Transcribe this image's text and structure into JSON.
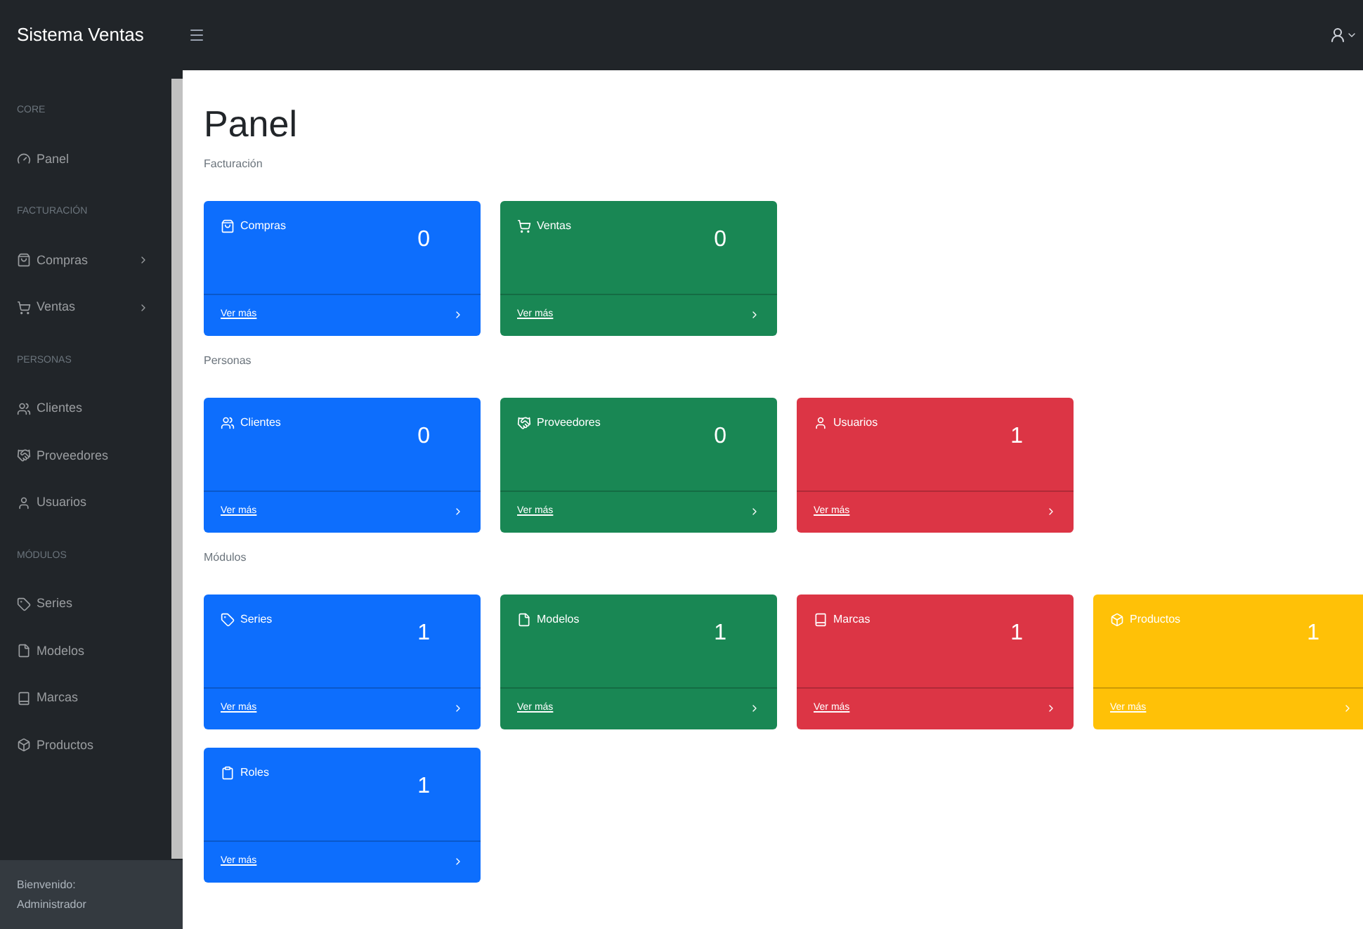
{
  "topbar": {
    "brand": "Sistema Ventas"
  },
  "sidebar": {
    "sections": [
      {
        "heading": "CORE",
        "items": [
          {
            "label": "Panel",
            "expandable": false
          }
        ]
      },
      {
        "heading": "FACTURACIÓN",
        "items": [
          {
            "label": "Compras",
            "expandable": true
          },
          {
            "label": "Ventas",
            "expandable": true
          }
        ]
      },
      {
        "heading": "PERSONAS",
        "items": [
          {
            "label": "Clientes",
            "expandable": false
          },
          {
            "label": "Proveedores",
            "expandable": false
          },
          {
            "label": "Usuarios",
            "expandable": false
          }
        ]
      },
      {
        "heading": "MÓDULOS",
        "items": [
          {
            "label": "Series",
            "expandable": false
          },
          {
            "label": "Modelos",
            "expandable": false
          },
          {
            "label": "Marcas",
            "expandable": false
          },
          {
            "label": "Productos",
            "expandable": false
          }
        ]
      }
    ],
    "footer": [
      "Bienvenido:",
      "Administrador"
    ]
  },
  "page": {
    "title": "Panel",
    "groups": [
      {
        "heading": "Facturación",
        "cards": [
          {
            "title": "Compras",
            "count": "0",
            "color": "#0d6efd",
            "link": "Ver más"
          },
          {
            "title": "Ventas",
            "count": "0",
            "color": "#198754",
            "link": "Ver más"
          }
        ]
      },
      {
        "heading": "Personas",
        "cards": [
          {
            "title": "Clientes",
            "count": "0",
            "color": "#0d6efd",
            "link": "Ver más"
          },
          {
            "title": "Proveedores",
            "count": "0",
            "color": "#198754",
            "link": "Ver más"
          },
          {
            "title": "Usuarios",
            "count": "1",
            "color": "#dc3545",
            "link": "Ver más"
          }
        ]
      },
      {
        "heading": "Módulos",
        "cards": [
          {
            "title": "Series",
            "count": "1",
            "color": "#0d6efd",
            "link": "Ver más"
          },
          {
            "title": "Modelos",
            "count": "1",
            "color": "#198754",
            "link": "Ver más"
          },
          {
            "title": "Marcas",
            "count": "1",
            "color": "#dc3545",
            "link": "Ver más"
          },
          {
            "title": "Productos",
            "count": "1",
            "color": "#ffc107",
            "link": "Ver más"
          },
          {
            "title": "Roles",
            "count": "1",
            "color": "#0d6efd",
            "link": "Ver más"
          }
        ]
      }
    ]
  }
}
